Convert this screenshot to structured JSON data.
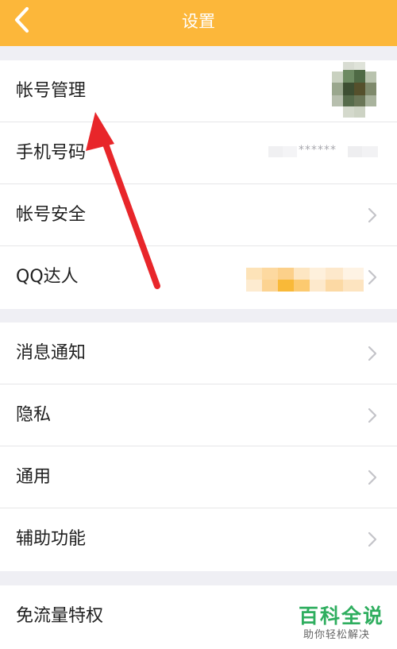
{
  "navbar": {
    "title": "设置",
    "back_icon": "chevron-left-icon",
    "background": "#fcb73a"
  },
  "groups": [
    {
      "items": [
        {
          "label": "帐号管理",
          "trailing": "avatar (blurred)"
        },
        {
          "label": "手机号码",
          "trailing_text": "******"
        },
        {
          "label": "帐号安全",
          "trailing": "chevron-right-icon"
        },
        {
          "label": "QQ达人",
          "trailing": "badge (blurred) + chevron-right-icon"
        }
      ]
    },
    {
      "items": [
        {
          "label": "消息通知",
          "trailing": "chevron-right-icon"
        },
        {
          "label": "隐私",
          "trailing": "chevron-right-icon"
        },
        {
          "label": "通用",
          "trailing": "chevron-right-icon"
        },
        {
          "label": "辅助功能",
          "trailing": "chevron-right-icon"
        }
      ]
    },
    {
      "items": [
        {
          "label": "免流量特权"
        }
      ]
    }
  ],
  "annotation": {
    "arrow_color": "#e8262a",
    "arrow_icon": "red-arrow-pointing-up"
  },
  "watermark": {
    "title": "百科全说",
    "subtitle": "助你轻松解决",
    "color": "#2fae5f"
  }
}
